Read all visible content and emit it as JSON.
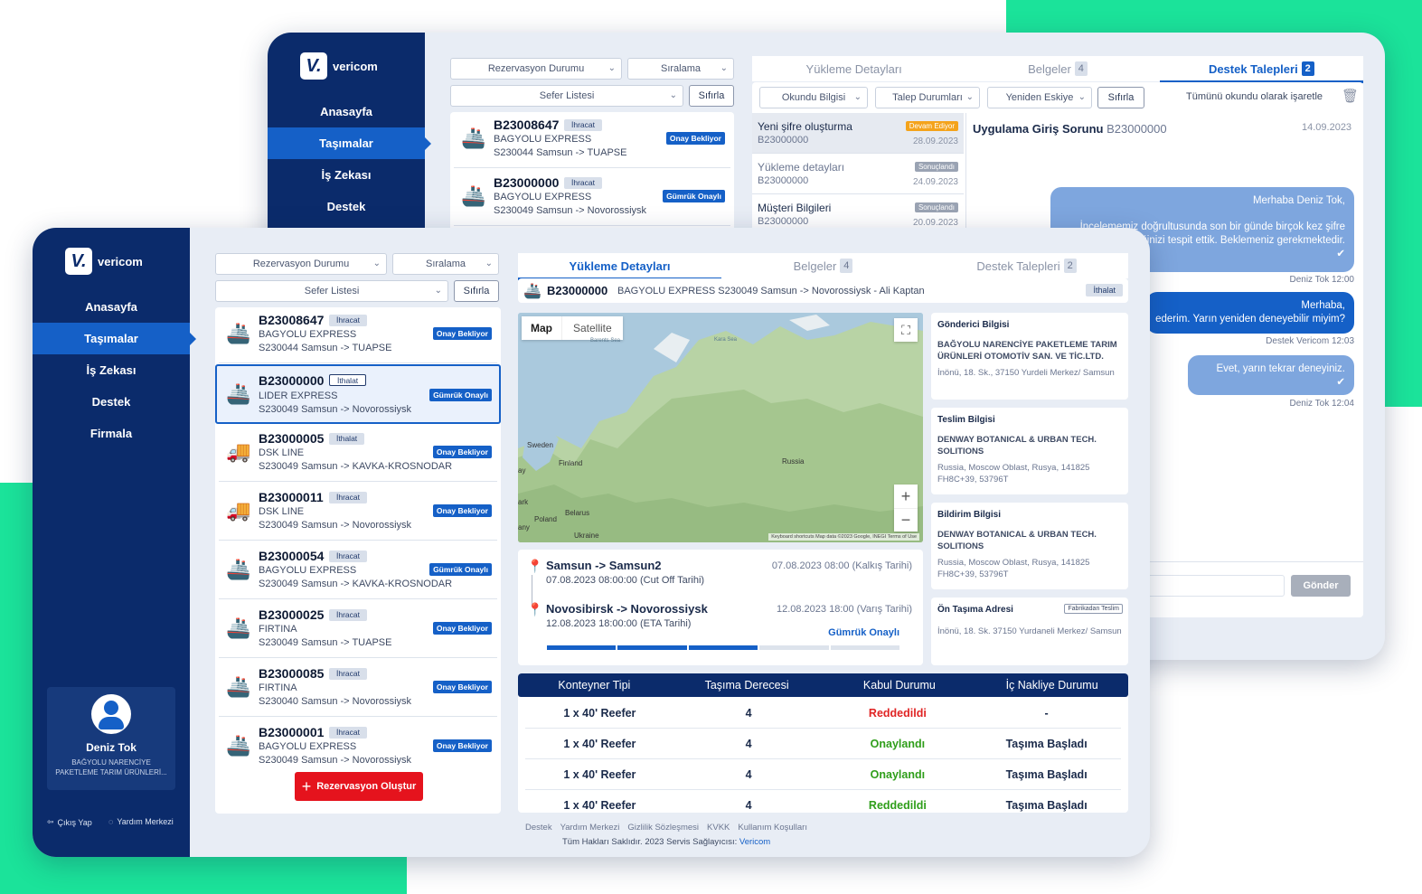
{
  "brand": {
    "name": "vericom",
    "mark": "V."
  },
  "colors": {
    "accent": "#1be39a",
    "navy": "#0b2b6b",
    "primary": "#1560c7",
    "danger": "#e02424",
    "success": "#2f9e1a"
  },
  "back": {
    "nav": [
      "Anasayfa",
      "Taşımalar",
      "İş Zekası",
      "Destek"
    ],
    "filters": {
      "rezervasyon": "Rezervasyon Durumu",
      "siralama": "Sıralama",
      "sefer": "Sefer Listesi",
      "reset": "Sıfırla"
    },
    "cards": [
      {
        "code": "B23008647",
        "type": "İhracat",
        "company": "BAGYOLU EXPRESS",
        "route": "S230044 Samsun -> TUAPSE",
        "status": "Onay Bekliyor"
      },
      {
        "code": "B23000000",
        "type": "İhracat",
        "company": "BAGYOLU EXPRESS",
        "route": "S230049 Samsun -> Novorossiysk",
        "status": "Gümrük Onaylı"
      }
    ],
    "tabs": [
      {
        "label": "Yükleme Detayları",
        "count": ""
      },
      {
        "label": "Belgeler",
        "count": "4"
      },
      {
        "label": "Destek Talepleri",
        "count": "2"
      }
    ],
    "ticket_filters": {
      "okundu": "Okundu Bilgisi",
      "talep": "Talep Durumları",
      "yeniden": "Yeniden Eskiye",
      "reset": "Sıfırla",
      "mark_all": "Tümünü okundu olarak işaretle"
    },
    "tickets": [
      {
        "title": "Yeni şifre oluşturma",
        "code": "B23000000",
        "status": "Devam Ediyor",
        "date": "28.09.2023"
      },
      {
        "title": "Yükleme detayları",
        "code": "B23000000",
        "status": "Sonuçlandı",
        "date": "24.09.2023"
      },
      {
        "title": "Müşteri Bilgileri",
        "code": "B23000000",
        "status": "Sonuçlandı",
        "date": "20.09.2023"
      }
    ],
    "chat": {
      "title": "Uygulama Giriş Sorunu",
      "code": "B23000000",
      "date": "14.09.2023",
      "m1": "Merhaba Deniz Tok,",
      "m1b": "İncelememiz doğrultusunda son bir günde birçok kez şifre",
      "m1c": "değiştirdiğinizi tespit ettik. Beklemeniz gerekmektedir.",
      "m1meta": "Deniz Tok 12:00",
      "m2": "Merhaba,",
      "m2b": "ederim. Yarın yeniden deneyebilir miyim?",
      "m2meta": "Destek Vericom 12:03",
      "m3": "Evet, yarın tekrar deneyiniz.",
      "m3meta": "Deniz Tok 12:04",
      "send": "Gönder"
    }
  },
  "front": {
    "nav": [
      "Anasayfa",
      "Taşımalar",
      "İş Zekası",
      "Destek",
      "Firmala"
    ],
    "filters": {
      "rezervasyon": "Rezervasyon Durumu",
      "siralama": "Sıralama",
      "sefer": "Sefer Listesi",
      "reset": "Sıfırla"
    },
    "cards": [
      {
        "code": "B23008647",
        "type": "İhracat",
        "company": "BAGYOLU EXPRESS",
        "route": "S230044 Samsun -> TUAPSE",
        "status": "Onay Bekliyor",
        "icon": "ship"
      },
      {
        "code": "B23000000",
        "type": "İthalat",
        "company": "LIDER EXPRESS",
        "route": "S230049 Samsun -> Novorossiysk",
        "status": "Gümrük Onaylı",
        "icon": "ship"
      },
      {
        "code": "B23000005",
        "type": "İthalat",
        "company": "DSK LINE",
        "route": "S230049 Samsun -> KAVKA-KROSNODAR",
        "status": "Onay Bekliyor",
        "icon": "truck"
      },
      {
        "code": "B23000011",
        "type": "İhracat",
        "company": "DSK LINE",
        "route": "S230049 Samsun -> Novorossiysk",
        "status": "Onay Bekliyor",
        "icon": "truck"
      },
      {
        "code": "B23000054",
        "type": "İhracat",
        "company": "BAGYOLU EXPRESS",
        "route": "S230049 Samsun -> KAVKA-KROSNODAR",
        "status": "Gümrük Onaylı",
        "icon": "ship"
      },
      {
        "code": "B23000025",
        "type": "İhracat",
        "company": "FIRTINA",
        "route": "S230049 Samsun -> TUAPSE",
        "status": "Onay Bekliyor",
        "icon": "ship"
      },
      {
        "code": "B23000085",
        "type": "İhracat",
        "company": "FIRTINA",
        "route": "S230040 Samsun -> Novorossiysk",
        "status": "Onay Bekliyor",
        "icon": "ship"
      },
      {
        "code": "B23000001",
        "type": "İhracat",
        "company": "BAGYOLU EXPRESS",
        "route": "S230049 Samsun -> Novorossiysk",
        "status": "Onay Bekliyor",
        "icon": "ship"
      }
    ],
    "create_button": "Rezervasyon Oluştur",
    "user": {
      "name": "Deniz Tok",
      "company1": "BAĞYOLU NARENCİYE",
      "company2": "PAKETLEME TARIM ÜRÜNLERİ..."
    },
    "logout": "Çıkış Yap",
    "help": "Yardım Merkezi",
    "tabs": [
      {
        "label": "Yükleme Detayları",
        "count": ""
      },
      {
        "label": "Belgeler",
        "count": "4"
      },
      {
        "label": "Destek Talepleri",
        "count": "2"
      }
    ],
    "summary": {
      "code": "B23000000",
      "desc": "BAGYOLU EXPRESS S230049 Samsun -> Novorossiysk - Ali Kaptan",
      "type": "İthalat"
    },
    "map": {
      "map_tab": "Map",
      "sat_tab": "Satellite",
      "labels": {
        "barents": "Barents Sea",
        "kara": "Kara Sea",
        "sweden": "Sweden",
        "finland": "Finland",
        "russia": "Russia",
        "poland": "Poland",
        "belarus": "Belarus",
        "ukraine": "Ukraine",
        "ay": "ay",
        "ark": "ark",
        "any": "any"
      },
      "attribution": "Keyboard shortcuts   Map data ©2023 Google, INEGI   Terms of Use"
    },
    "route": {
      "from": "Samsun -> Samsun2",
      "from_time": "07.08.2023 08:00:00 (Cut Off Tarihi)",
      "from_right": "07.08.2023 08:00 (Kalkış Tarihi)",
      "to": "Novosibirsk -> Novorossiysk",
      "to_time": "12.08.2023 18:00:00 (ETA Tarihi)",
      "to_right": "12.08.2023 18:00 (Varış Tarihi)",
      "status": "Gümrük Onaylı",
      "progress": 0.6
    },
    "sender": {
      "heading": "Gönderici Bilgisi",
      "name": "BAĞYOLU NARENCİYE PAKETLEME TARIM ÜRÜNLERİ OTOMOTİV SAN. VE TİC.LTD.",
      "address": "İnönü, 18. Sk., 37150 Yurdeli Merkez/ Samsun"
    },
    "delivery": {
      "heading": "Teslim Bilgisi",
      "name": "DENWAY BOTANICAL & URBAN TECH. SOLITIONS",
      "address": "Russia, Moscow Oblast, Rusya, 141825 FH8C+39, 53796T"
    },
    "notify": {
      "heading": "Bildirim Bilgisi",
      "name": "DENWAY BOTANICAL & URBAN TECH. SOLITIONS",
      "address": "Russia, Moscow Oblast, Rusya, 141825 FH8C+39, 53796T"
    },
    "pre": {
      "heading": "Ön Taşıma Adresi",
      "tag": "Fabrikadan Teslim",
      "address": "İnönü, 18. Sk. 37150 Yurdaneli Merkez/ Samsun"
    },
    "table": {
      "headers": [
        "Konteyner Tipi",
        "Taşıma Derecesi",
        "Kabul Durumu",
        "İç Nakliye Durumu"
      ],
      "rows": [
        [
          "1 x 40' Reefer",
          "4",
          "Reddedildi",
          "-"
        ],
        [
          "1 x 40' Reefer",
          "4",
          "Onaylandı",
          "Taşıma Başladı"
        ],
        [
          "1 x 40' Reefer",
          "4",
          "Onaylandı",
          "Taşıma Başladı"
        ],
        [
          "1 x 40' Reefer",
          "4",
          "Reddedildi",
          "Taşıma Başladı"
        ]
      ]
    },
    "footer": {
      "links": [
        "Destek",
        "Yardım Merkezi",
        "Gizlilik Sözleşmesi",
        "KVKK",
        "Kullanım Koşulları"
      ],
      "copyright": "Tüm Hakları Saklıdır. 2023 Servis Sağlayıcısı:",
      "provider": "Vericom"
    }
  }
}
